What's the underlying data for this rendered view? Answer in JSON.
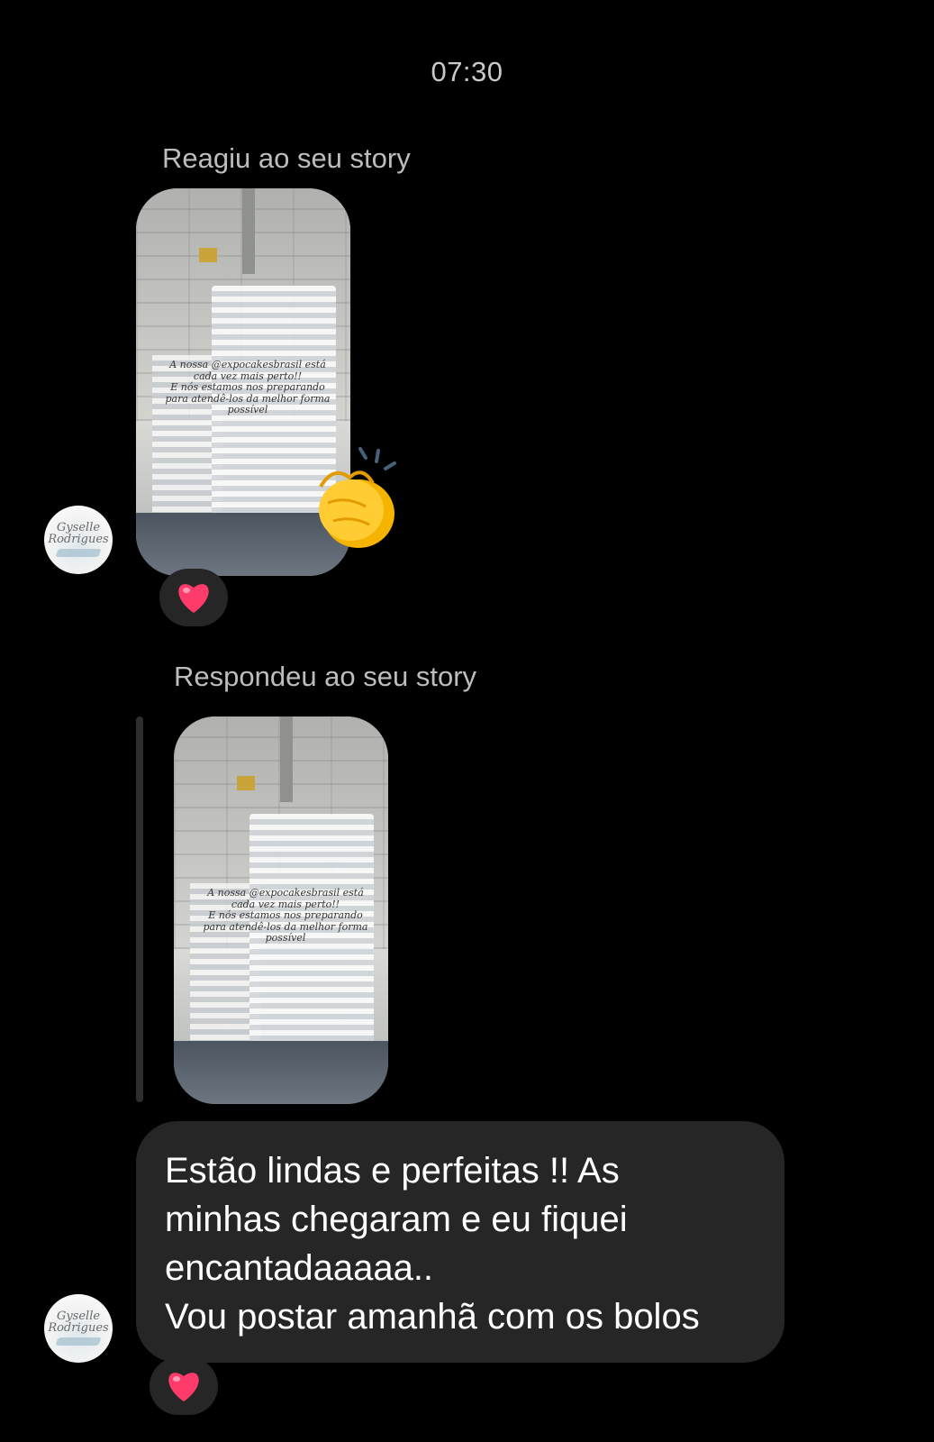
{
  "header": {
    "timestamp": "07:30"
  },
  "messages": [
    {
      "caption": "Reagiu ao seu story",
      "story_overlay": "A nossa @expocakesbrasil está\ncada vez mais perto!!\nE nós estamos nos preparando\npara atendê-los da melhor forma\npossível",
      "reaction_emoji": "clapping-hands",
      "like_reaction": "heart"
    },
    {
      "caption": "Respondeu ao seu story",
      "story_overlay": "A nossa @expocakesbrasil está\ncada vez mais perto!!\nE nós estamos nos preparando\npara atendê-los da melhor forma\npossível",
      "reply_text": "Estão lindas e perfeitas !! As\nminhas chegaram e eu fiquei\nencantadaaaaa..\nVou postar amanhã com os bolos",
      "like_reaction": "heart"
    }
  ],
  "avatar": {
    "monogram": "Gyselle\nRodrigues"
  },
  "colors": {
    "background": "#000000",
    "bubble": "#262626",
    "caption": "#bdbdbd",
    "heart": "#ff3b6b"
  }
}
